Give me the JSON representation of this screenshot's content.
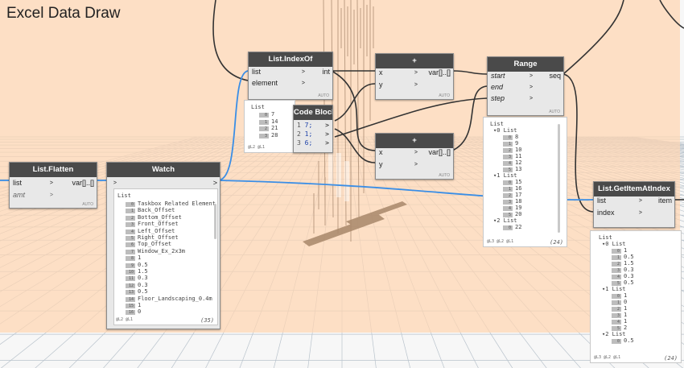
{
  "group": {
    "title": "Excel Data Draw"
  },
  "nodes": {
    "flatten": {
      "title": "List.Flatten",
      "inputs": [
        "list",
        "amt"
      ],
      "output": "var[]..[]",
      "auto": "AUTO"
    },
    "watch": {
      "title": "Watch",
      "footer": "@L2 @L1",
      "count": "(35)",
      "root": "List",
      "items": [
        {
          "i": "0",
          "v": "Taskbox Related Element"
        },
        {
          "i": "1",
          "v": "Back_Offset"
        },
        {
          "i": "2",
          "v": "Bottom_Offset"
        },
        {
          "i": "3",
          "v": "Front_Offset"
        },
        {
          "i": "4",
          "v": "Left_Offset"
        },
        {
          "i": "5",
          "v": "Right_Offset"
        },
        {
          "i": "6",
          "v": "Top_Offset"
        },
        {
          "i": "7",
          "v": "Window_Ex_2x3m"
        },
        {
          "i": "8",
          "v": "1"
        },
        {
          "i": "9",
          "v": "0.5"
        },
        {
          "i": "10",
          "v": "1.5"
        },
        {
          "i": "11",
          "v": "0.3"
        },
        {
          "i": "12",
          "v": "0.3"
        },
        {
          "i": "13",
          "v": "0.5"
        },
        {
          "i": "14",
          "v": "Floor_Landscaping_0.4m"
        },
        {
          "i": "15",
          "v": "1"
        },
        {
          "i": "16",
          "v": "0"
        }
      ]
    },
    "indexof": {
      "title": "List.IndexOf",
      "inputs": [
        "list",
        "element"
      ],
      "output": "int",
      "auto": "AUTO",
      "preview": {
        "root": "List",
        "items": [
          {
            "i": "0",
            "v": "7"
          },
          {
            "i": "1",
            "v": "14"
          },
          {
            "i": "2",
            "v": "21"
          },
          {
            "i": "3",
            "v": "28"
          }
        ],
        "footer": "@L2 @L1"
      }
    },
    "codeblock": {
      "title": "Code Block",
      "lines": [
        {
          "n": "1",
          "code": "7;"
        },
        {
          "n": "2",
          "code": "1;"
        },
        {
          "n": "3",
          "code": "6;"
        }
      ]
    },
    "add_top": {
      "title": "+",
      "inputs": [
        "x",
        "y"
      ],
      "output": "var[]..[]",
      "auto": "AUTO"
    },
    "add_bottom": {
      "title": "+",
      "inputs": [
        "x",
        "y"
      ],
      "output": "var[]..[]",
      "auto": "AUTO"
    },
    "range": {
      "title": "Range",
      "inputs": [
        "start",
        "end",
        "step"
      ],
      "output": "seq",
      "auto": "AUTO",
      "preview": {
        "root": "List",
        "groups": [
          {
            "label": "0 List",
            "items": [
              {
                "i": "0",
                "v": "8"
              },
              {
                "i": "1",
                "v": "9"
              },
              {
                "i": "2",
                "v": "10"
              },
              {
                "i": "3",
                "v": "11"
              },
              {
                "i": "4",
                "v": "12"
              },
              {
                "i": "5",
                "v": "13"
              }
            ]
          },
          {
            "label": "1 List",
            "items": [
              {
                "i": "0",
                "v": "15"
              },
              {
                "i": "1",
                "v": "16"
              },
              {
                "i": "2",
                "v": "17"
              },
              {
                "i": "3",
                "v": "18"
              },
              {
                "i": "4",
                "v": "19"
              },
              {
                "i": "5",
                "v": "20"
              }
            ]
          },
          {
            "label": "2 List",
            "items": [
              {
                "i": "0",
                "v": "22"
              }
            ]
          }
        ],
        "footer": "@L3 @L2 @L1",
        "count": "(24)"
      }
    },
    "getitem": {
      "title": "List.GetItemAtIndex",
      "inputs": [
        "list",
        "index"
      ],
      "output": "item",
      "preview": {
        "root": "List",
        "groups": [
          {
            "label": "0 List",
            "items": [
              {
                "i": "0",
                "v": "1"
              },
              {
                "i": "1",
                "v": "0.5"
              },
              {
                "i": "2",
                "v": "1.5"
              },
              {
                "i": "3",
                "v": "0.3"
              },
              {
                "i": "4",
                "v": "0.3"
              },
              {
                "i": "5",
                "v": "0.5"
              }
            ]
          },
          {
            "label": "1 List",
            "items": [
              {
                "i": "0",
                "v": "1"
              },
              {
                "i": "1",
                "v": "0"
              },
              {
                "i": "2",
                "v": "1"
              },
              {
                "i": "3",
                "v": "1"
              },
              {
                "i": "4",
                "v": "1"
              },
              {
                "i": "5",
                "v": "2"
              }
            ]
          },
          {
            "label": "2 List",
            "items": [
              {
                "i": "0",
                "v": "0.5"
              }
            ]
          }
        ],
        "footer": "@L3 @L2 @L1",
        "count": "(24)"
      }
    }
  },
  "colors": {
    "group": "#ffd6b2",
    "header": "#4a4a4a",
    "wire": "#333333",
    "wire_selected": "#3a8ee6"
  }
}
